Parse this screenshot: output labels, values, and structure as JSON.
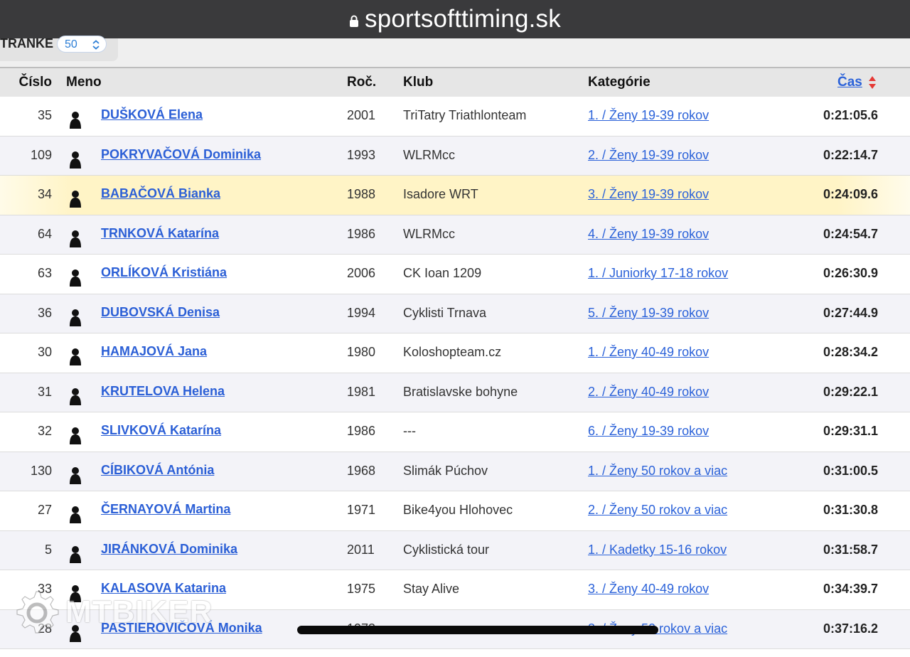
{
  "browser": {
    "url": "sportsofttiming.sk"
  },
  "pager": {
    "label": "TRANKE",
    "value": "50"
  },
  "table": {
    "headers": {
      "num": "Číslo",
      "name": "Meno",
      "year": "Roč.",
      "club": "Klub",
      "category": "Kategórie",
      "time": "Čas"
    },
    "rows": [
      {
        "num": "35",
        "name": "DUŠKOVÁ Elena",
        "year": "2001",
        "club": "TriTatry Triathlonteam",
        "category": "1. /  Ženy 19-39 rokov",
        "time": "0:21:05.6"
      },
      {
        "num": "109",
        "name": "POKRYVAČOVÁ Dominika",
        "year": "1993",
        "club": "WLRMcc",
        "category": "2. /  Ženy 19-39 rokov",
        "time": "0:22:14.7"
      },
      {
        "num": "34",
        "name": "BABAČOVÁ Bianka",
        "year": "1988",
        "club": "Isadore WRT",
        "category": "3. /  Ženy 19-39 rokov",
        "time": "0:24:09.6"
      },
      {
        "num": "64",
        "name": "TRNKOVÁ Katarína",
        "year": "1986",
        "club": "WLRMcc",
        "category": "4. /  Ženy 19-39 rokov",
        "time": "0:24:54.7"
      },
      {
        "num": "63",
        "name": "ORLÍKOVÁ Kristiána",
        "year": "2006",
        "club": "CK Ioan 1209",
        "category": "1. /  Juniorky 17-18 rokov",
        "time": "0:26:30.9"
      },
      {
        "num": "36",
        "name": "DUBOVSKÁ Denisa",
        "year": "1994",
        "club": "Cyklisti Trnava",
        "category": "5. /  Ženy 19-39 rokov",
        "time": "0:27:44.9"
      },
      {
        "num": "30",
        "name": "HAMAJOVÁ Jana",
        "year": "1980",
        "club": "Koloshopteam.cz",
        "category": "1. /  Ženy 40-49 rokov",
        "time": "0:28:34.2"
      },
      {
        "num": "31",
        "name": "KRUTELOVA Helena",
        "year": "1981",
        "club": "Bratislavske bohyne",
        "category": "2. /  Ženy 40-49 rokov",
        "time": "0:29:22.1"
      },
      {
        "num": "32",
        "name": "SLIVKOVÁ Katarína",
        "year": "1986",
        "club": "---",
        "category": "6. /  Ženy 19-39 rokov",
        "time": "0:29:31.1"
      },
      {
        "num": "130",
        "name": "CÍBIKOVÁ Antónia",
        "year": "1968",
        "club": "Slimák Púchov",
        "category": "1. /  Ženy 50 rokov a viac",
        "time": "0:31:00.5"
      },
      {
        "num": "27",
        "name": "ČERNAYOVÁ Martina",
        "year": "1971",
        "club": "Bike4you Hlohovec",
        "category": "2. /  Ženy 50 rokov a viac",
        "time": "0:31:30.8"
      },
      {
        "num": "5",
        "name": "JIRÁNKOVÁ Dominika",
        "year": "2011",
        "club": "Cyklistická tour",
        "category": "1. /  Kadetky 15-16 rokov",
        "time": "0:31:58.7"
      },
      {
        "num": "33",
        "name": "KALASOVA Katarina",
        "year": "1975",
        "club": "Stay Alive",
        "category": "3. /  Ženy 40-49 rokov",
        "time": "0:34:39.7"
      },
      {
        "num": "28",
        "name": "PASTIEROVIČOVÁ Monika",
        "year": "1973",
        "club": "---",
        "category": "3. /  Ženy 50 rokov a viac",
        "time": "0:37:16.2"
      }
    ]
  },
  "watermark": {
    "text": "MTBIKER"
  },
  "icons": {
    "lock": "lock-icon",
    "person": "person-icon",
    "sort": "sort-icon",
    "stepper": "chevron-updown-icon"
  },
  "colors": {
    "link": "#2b5fd6",
    "highlight": "#fff4c6",
    "urlbar": "#3a3a3c",
    "sort_up": "#e53935"
  }
}
